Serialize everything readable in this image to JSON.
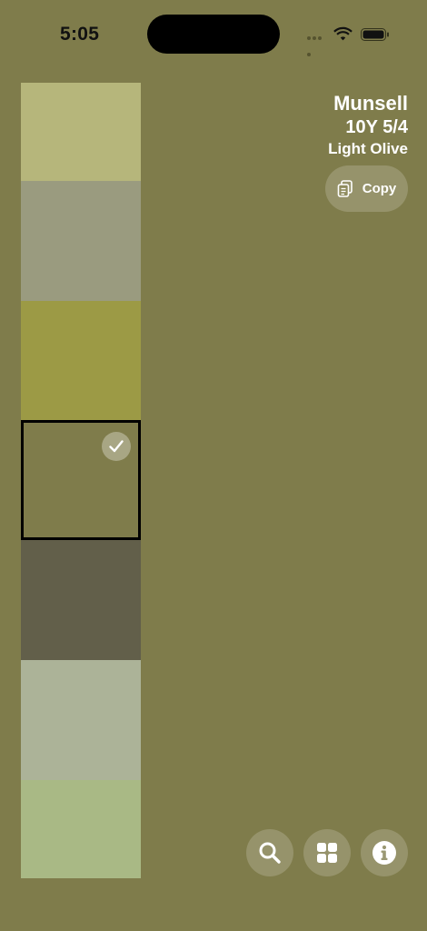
{
  "status_bar": {
    "time": "5:05"
  },
  "color_info": {
    "system": "Munsell",
    "code": "10Y 5/4",
    "name": "Light Olive"
  },
  "copy_button": {
    "label": "Copy",
    "icon": "copy-icon"
  },
  "swatches": [
    {
      "color": "#b6b67b",
      "selected": false
    },
    {
      "color": "#9a9b7f",
      "selected": false
    },
    {
      "color": "#9c9a45",
      "selected": false
    },
    {
      "color": "#7f7c4b",
      "selected": true
    },
    {
      "color": "#625f4a",
      "selected": false
    },
    {
      "color": "#acb398",
      "selected": false
    },
    {
      "color": "#a9b985",
      "selected": false
    }
  ],
  "bottom_buttons": [
    {
      "icon": "search-icon"
    },
    {
      "icon": "grid-icon"
    },
    {
      "icon": "info-icon"
    }
  ],
  "colors": {
    "background": "#7f7c4b",
    "selection_border": "#000000"
  }
}
